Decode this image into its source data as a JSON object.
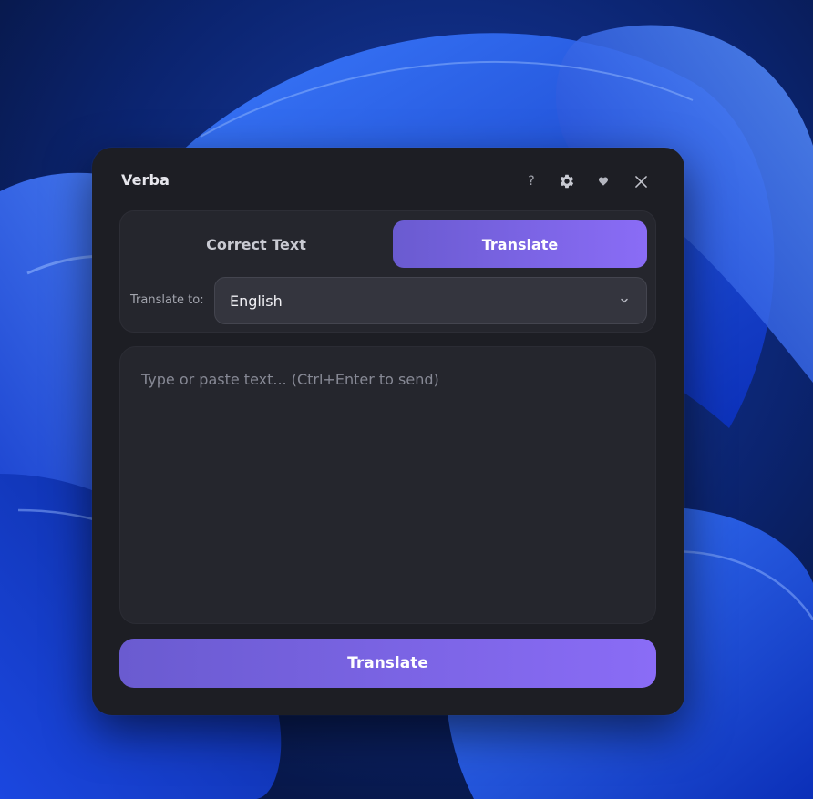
{
  "window": {
    "title": "Verba",
    "controls": {
      "help_label": "?",
      "settings_icon": "gear-icon",
      "heart_icon": "heart-icon",
      "close_icon": "close-icon"
    }
  },
  "modes": {
    "tabs": [
      {
        "label": "Correct Text",
        "active": false
      },
      {
        "label": "Translate",
        "active": true
      }
    ]
  },
  "language": {
    "label": "Translate to:",
    "selected": "English",
    "chevron_icon": "chevron-down-icon"
  },
  "input": {
    "value": "",
    "placeholder": "Type or paste text... (Ctrl+Enter to send)"
  },
  "action": {
    "label": "Translate"
  },
  "colors": {
    "accent_start": "#6a5bd0",
    "accent_end": "#8a6cf6",
    "window_bg": "#1d1e24",
    "panel_bg": "#25262d",
    "wallpaper": "#0a1a4a"
  }
}
